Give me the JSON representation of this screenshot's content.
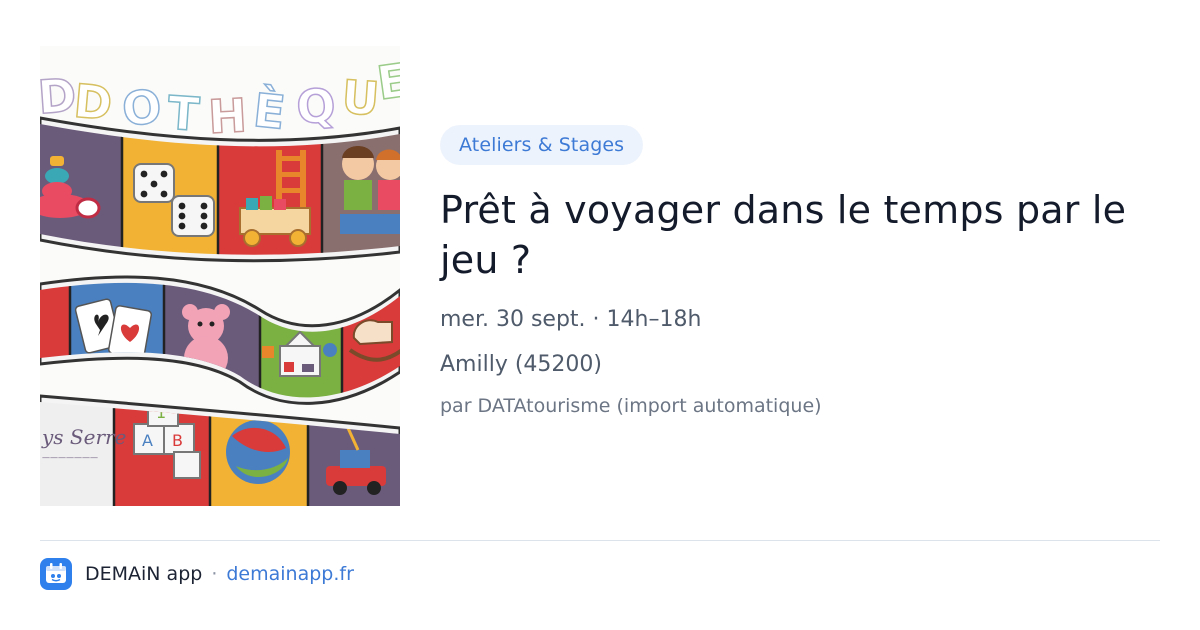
{
  "image": {
    "banner_text": "DOTHÈQUE",
    "corner_logo_text": "ys Serre",
    "colors": {
      "red": "#d93a3a",
      "yellow": "#f2b233",
      "green": "#7bb043",
      "purple": "#6b5b7b",
      "orange": "#e7862b"
    }
  },
  "event": {
    "category": "Ateliers & Stages",
    "title": "Prêt à voyager dans le temps par le jeu ?",
    "datetime": "mer. 30 sept. · 14h–18h",
    "location": "Amilly (45200)",
    "source": "par DATAtourisme (import automatique)"
  },
  "footer": {
    "app_name": "DEMAiN app",
    "separator": "·",
    "site": "demainapp.fr",
    "logo_icon": "app-logo-icon"
  },
  "colors": {
    "accent": "#3d7ad6",
    "badge_bg": "#edf3fc",
    "title": "#141b2b",
    "meta": "#4f5a6a",
    "logo_bg": "#2f80ed"
  }
}
